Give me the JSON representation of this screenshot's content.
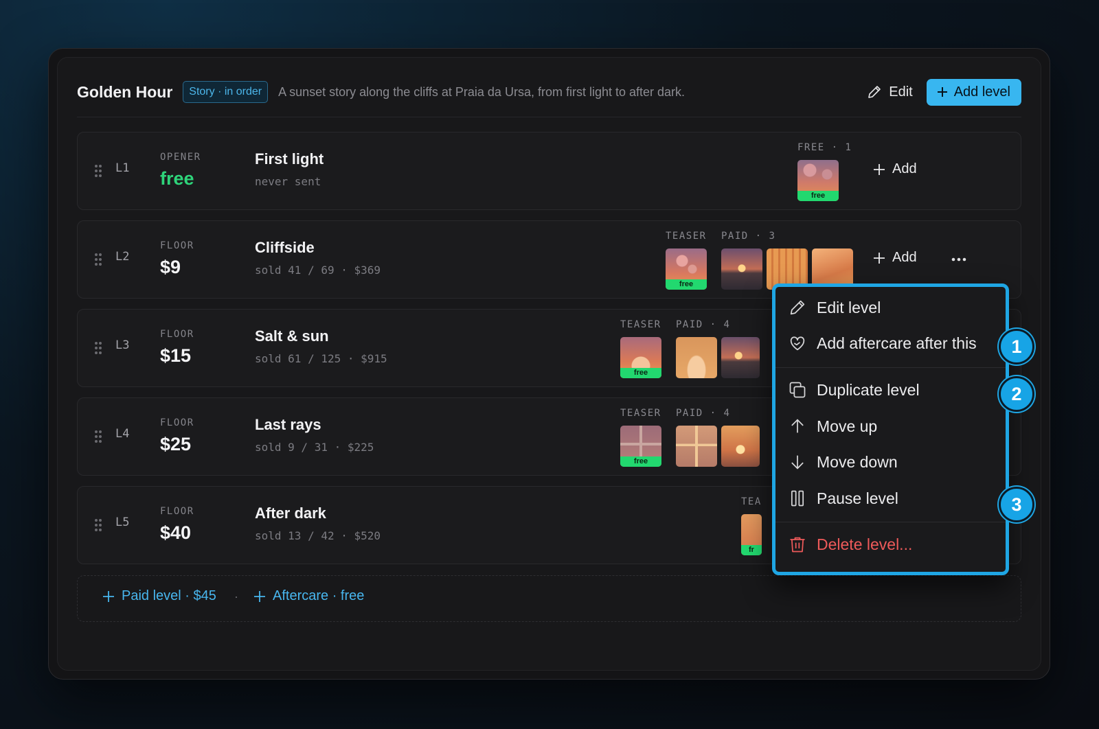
{
  "header": {
    "title": "Golden Hour",
    "badge": "Story · in order",
    "description": "A sunset story along the cliffs at Praia da Ursa, from first light to after dark.",
    "edit_label": "Edit",
    "add_level_label": "Add level"
  },
  "levels": [
    {
      "id": "L1",
      "kind": "OPENER",
      "price": "free",
      "name": "First light",
      "stats": "never sent",
      "free_caption": "FREE · 1",
      "add_label": "Add",
      "thumb_label": "free"
    },
    {
      "id": "L2",
      "kind": "FLOOR",
      "price": "$9",
      "name": "Cliffside",
      "stats": "sold 41 / 69 · $369",
      "teaser_caption": "TEASER",
      "paid_caption": "PAID · 3",
      "add_label": "Add",
      "thumb_label": "free"
    },
    {
      "id": "L3",
      "kind": "FLOOR",
      "price": "$15",
      "name": "Salt & sun",
      "stats": "sold 61 / 125 · $915",
      "teaser_caption": "TEASER",
      "paid_caption": "PAID · 4",
      "thumb_label": "free"
    },
    {
      "id": "L4",
      "kind": "FLOOR",
      "price": "$25",
      "name": "Last rays",
      "stats": "sold 9 / 31 · $225",
      "teaser_caption": "TEASER",
      "paid_caption": "PAID · 4",
      "thumb_label": "free"
    },
    {
      "id": "L5",
      "kind": "FLOOR",
      "price": "$40",
      "name": "After dark",
      "stats": "sold 13 / 42 · $520",
      "teaser_caption": "TEA",
      "thumb_label": "fr"
    }
  ],
  "add_row": {
    "paid_label": "Paid level · $45",
    "separator": "·",
    "aftercare_label": "Aftercare · free"
  },
  "menu": {
    "items": [
      {
        "label": "Edit level",
        "icon": "pencil-icon"
      },
      {
        "label": "Add aftercare after this",
        "icon": "heart-hands-icon"
      },
      {
        "label": "Duplicate level",
        "icon": "duplicate-icon"
      },
      {
        "label": "Move up",
        "icon": "arrow-up-icon"
      },
      {
        "label": "Move down",
        "icon": "arrow-down-icon"
      },
      {
        "label": "Pause level",
        "icon": "pause-icon"
      },
      {
        "label": "Delete level...",
        "icon": "trash-icon"
      }
    ]
  },
  "callouts": [
    "1",
    "2",
    "3"
  ],
  "colors": {
    "accent": "#38b6f0",
    "free_green": "#2ed47a",
    "danger": "#ee5a5a",
    "callout": "#17a4e6"
  }
}
